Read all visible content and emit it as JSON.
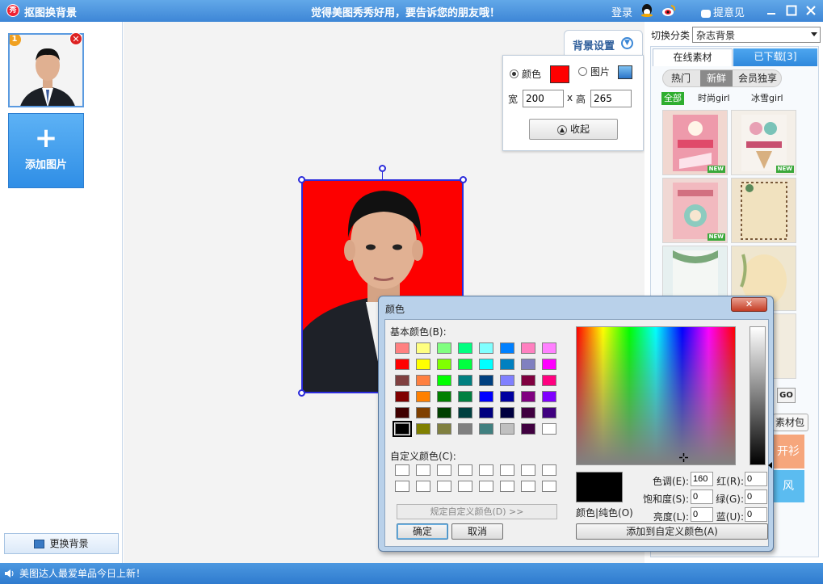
{
  "app": {
    "logo_text": "秀",
    "title": "抠图换背景",
    "slogan": "觉得美图秀秀好用，要告诉您的朋友哦！",
    "login": "登录",
    "feedback": "提意见"
  },
  "left": {
    "thumb_number": "1",
    "thumb_close": "✕",
    "add_image": "添加图片",
    "change_bg": "更换背景"
  },
  "bg_settings": {
    "tab_label": "背景设置",
    "color_label": "颜色",
    "image_label": "图片",
    "selected_color": "#ff0000",
    "width_label": "宽",
    "width_value": "200",
    "x_sep": "x",
    "height_label": "高",
    "height_value": "265",
    "collapse": "收起"
  },
  "right": {
    "category_label": "切换分类",
    "category_value": "杂志背景",
    "tab_online": "在线素材",
    "tab_downloaded": "已下载[3]",
    "subtabs": [
      "热门",
      "新鲜",
      "会员独享"
    ],
    "filters": [
      "全部",
      "时尚girl",
      "冰雪girl"
    ],
    "new_badge": "NEW",
    "go": "GO",
    "package": "素材包",
    "promo1": "开衫",
    "promo2": "风"
  },
  "status": {
    "text": "美图达人最爱单品今日上新！"
  },
  "color_dialog": {
    "title": "颜色",
    "close": "✕",
    "basic_colors_label": "基本颜色(B):",
    "custom_colors_label": "自定义颜色(C):",
    "define_custom": "规定自定义颜色(D) >>",
    "ok": "确定",
    "cancel": "取消",
    "color_solid_label": "颜色|纯色(O)",
    "hue_label": "色调(E):",
    "hue_value": "160",
    "sat_label": "饱和度(S):",
    "sat_value": "0",
    "lum_label": "亮度(L):",
    "lum_value": "0",
    "red_label": "红(R):",
    "red_value": "0",
    "green_label": "绿(G):",
    "green_value": "0",
    "blue_label": "蓝(U):",
    "blue_value": "0",
    "add_custom": "添加到自定义颜色(A)",
    "basic_colors": [
      "#ff8080",
      "#ffff80",
      "#80ff80",
      "#00ff80",
      "#80ffff",
      "#0080ff",
      "#ff80c0",
      "#ff80ff",
      "#ff0000",
      "#ffff00",
      "#80ff00",
      "#00ff40",
      "#00ffff",
      "#0080c0",
      "#8080c0",
      "#ff00ff",
      "#804040",
      "#ff8040",
      "#00ff00",
      "#008080",
      "#004080",
      "#8080ff",
      "#800040",
      "#ff0080",
      "#800000",
      "#ff8000",
      "#008000",
      "#008040",
      "#0000ff",
      "#0000a0",
      "#800080",
      "#8000ff",
      "#400000",
      "#804000",
      "#004000",
      "#004040",
      "#000080",
      "#000040",
      "#400040",
      "#400080",
      "#000000",
      "#808000",
      "#808040",
      "#808080",
      "#408080",
      "#c0c0c0",
      "#400040",
      "#ffffff"
    ]
  }
}
